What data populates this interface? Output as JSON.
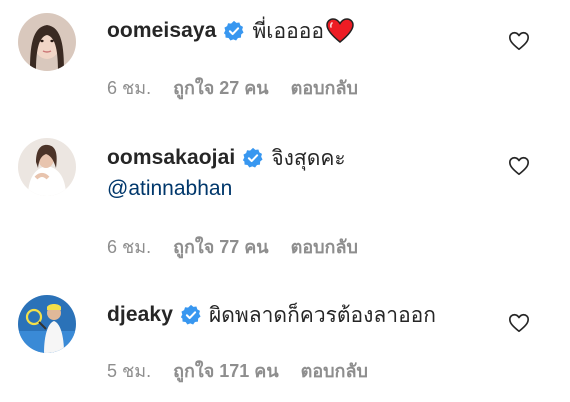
{
  "comments": [
    {
      "username": "oomeisaya",
      "text": "พี่เออออ",
      "mention": "",
      "time": "6 ชม.",
      "likes": "ถูกใจ 27 คน",
      "reply": "ตอบกลับ",
      "verified": true,
      "emoji": "red-heart-icon"
    },
    {
      "username": "oomsakaojai",
      "text": "จิงสุดคะ",
      "mention": "@atinnabhan",
      "time": "6 ชม.",
      "likes": "ถูกใจ 77 คน",
      "reply": "ตอบกลับ",
      "verified": true
    },
    {
      "username": "djeaky",
      "text": "ผิดพลาดก็ควรต้องลาออก",
      "mention": "",
      "time": "5 ชม.",
      "likes": "ถูกใจ 171 คน",
      "reply": "ตอบกลับ",
      "verified": true
    }
  ],
  "colors": {
    "verified": "#3897f0",
    "mention": "#00376b",
    "meta": "#8e8e8e",
    "heart": "#ed1c24"
  }
}
